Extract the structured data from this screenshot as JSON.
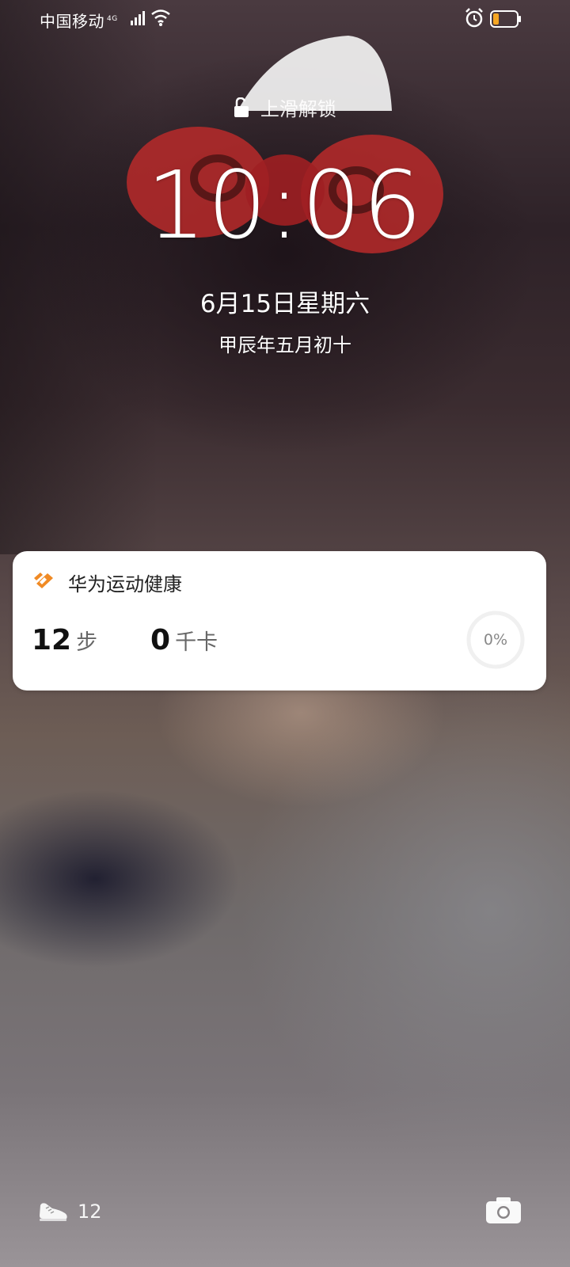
{
  "status_bar": {
    "carrier": "中国移动",
    "network": "4G"
  },
  "lockscreen": {
    "unlock_hint": "上滑解锁",
    "time": "10:06",
    "date": "6月15日星期六",
    "lunar_date": "甲辰年五月初十"
  },
  "health_card": {
    "app_name": "华为运动健康",
    "steps_value": "12",
    "steps_unit": "步",
    "calories_value": "0",
    "calories_unit": "千卡",
    "goal_progress_label": "0%",
    "goal_progress": 0
  },
  "bottom_bar": {
    "steps": "12"
  },
  "colors": {
    "accent_orange": "#F08A24",
    "battery_low": "#F5A623"
  }
}
